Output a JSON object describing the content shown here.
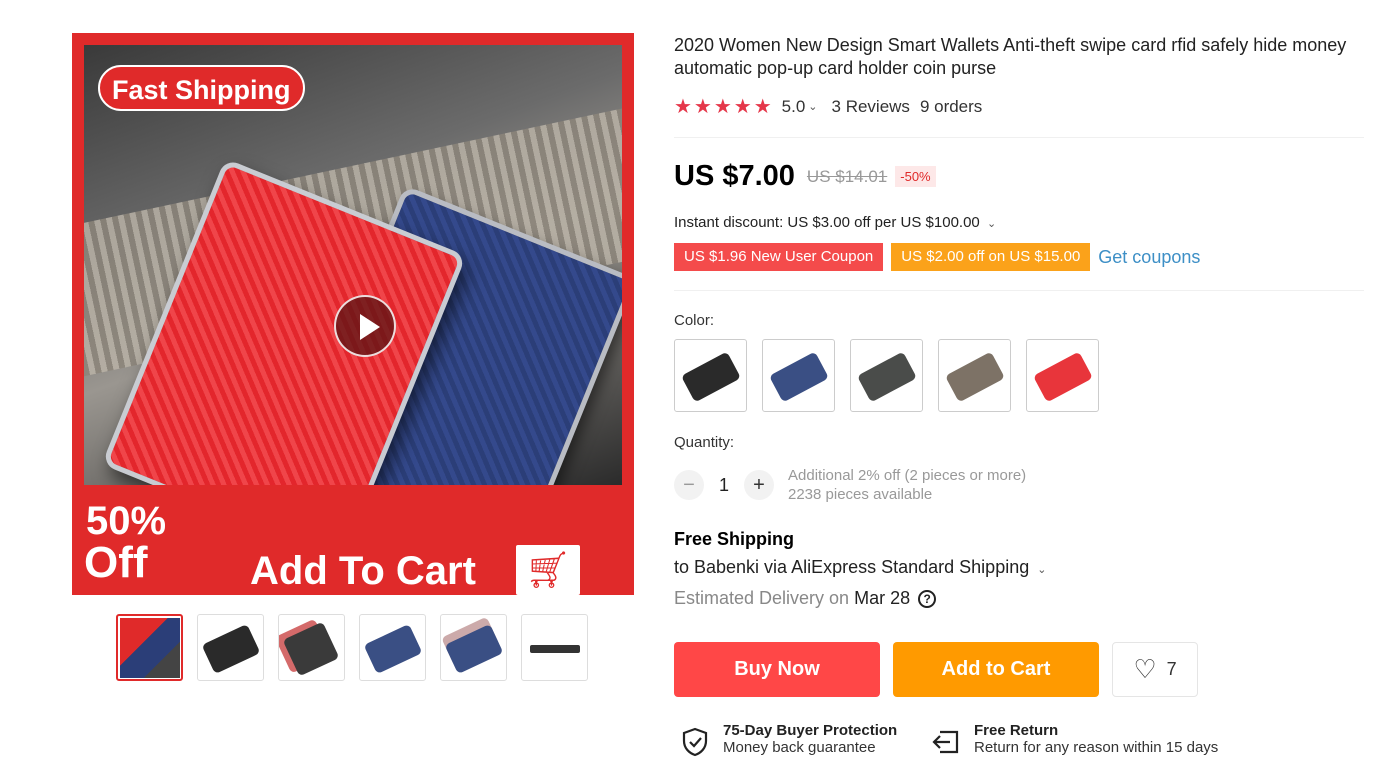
{
  "gallery": {
    "badge_fast": "Fast Shipping",
    "off_percent": "50%",
    "off_word": "Off",
    "banner_cta": "Add To Cart",
    "thumbnail_count": 6
  },
  "product": {
    "title": "2020 Women New Design Smart Wallets Anti-theft swipe card rfid safely hide money automatic pop-up card holder coin purse",
    "stars": "★★★★★",
    "rating": "5.0",
    "reviews": "3 Reviews",
    "orders": "9 orders"
  },
  "price": {
    "current": "US $7.00",
    "original": "US $14.01",
    "discount": "-50%",
    "instant_discount": "Instant discount: US $3.00 off per US $100.00",
    "coupon_new_user": "US $1.96 New User Coupon",
    "coupon_off": "US $2.00 off on US $15.00",
    "get_coupons": "Get coupons"
  },
  "color": {
    "label": "Color:",
    "swatches": [
      "#2a2a2a",
      "#3a4f84",
      "#4a4c4a",
      "#7d7266",
      "#e8353b"
    ]
  },
  "quantity": {
    "label": "Quantity:",
    "minus": "−",
    "plus": "+",
    "value": "1",
    "additional": "Additional 2% off (2 pieces or more)",
    "available": "2238 pieces available"
  },
  "shipping": {
    "title": "Free Shipping",
    "via": "to Babenki via AliExpress Standard Shipping",
    "estimated_label": "Estimated Delivery on",
    "estimated_date": "Mar 28",
    "help": "?"
  },
  "actions": {
    "buy_now": "Buy Now",
    "add_to_cart": "Add to Cart",
    "wish_count": "7"
  },
  "guarantees": {
    "protection_title": "75-Day Buyer Protection",
    "protection_sub": "Money back guarantee",
    "return_title": "Free Return",
    "return_sub": "Return for any reason within 15 days"
  },
  "colors": {
    "primary_red": "#ff4747",
    "accent_orange": "#ff9a00",
    "star_color": "#e5374a",
    "link_blue": "#3d8fc6"
  }
}
